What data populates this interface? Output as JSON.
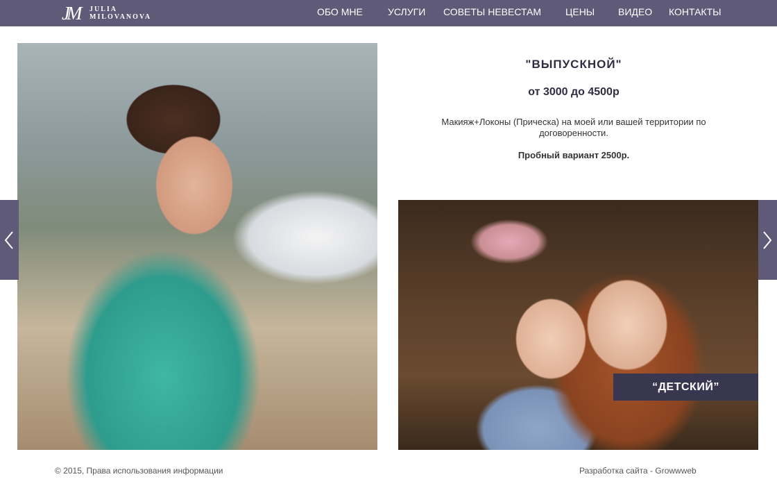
{
  "header": {
    "logo": {
      "mark": "JM",
      "line1": "JULIA",
      "line2": "MILOVANOVA"
    },
    "nav": [
      {
        "label": "ОБО МНЕ"
      },
      {
        "label": "УСЛУГИ"
      },
      {
        "label": "СОВЕТЫ НЕВЕСТАМ"
      },
      {
        "label": "ЦЕНЫ"
      },
      {
        "label": "ВИДЕО"
      },
      {
        "label": "КОНТАКТЫ"
      }
    ]
  },
  "service": {
    "title": "\"ВЫПУСКНОЙ\"",
    "price": "от 3000 до 4500р",
    "description": "Макияж+Локоны (Прическа) на моей или вашей территории по договоренности.",
    "trial": "Пробный вариант 2500р."
  },
  "gallery": {
    "next_label": "“ДЕТСКИЙ”"
  },
  "footer": {
    "copyright": "© 2015, Права использования информации",
    "developer": "Разработка сайта - Growwweb"
  },
  "colors": {
    "header_bg": "#5e5a78",
    "label_bg": "#393650"
  }
}
